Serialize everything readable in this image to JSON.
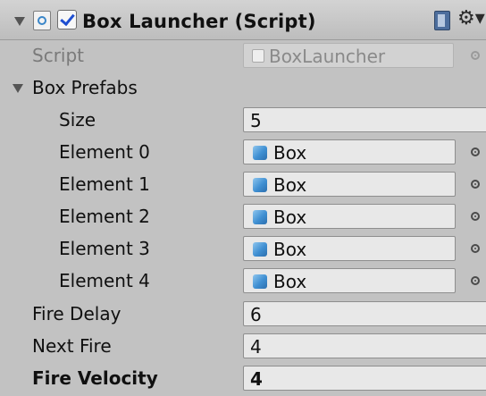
{
  "component": {
    "title": "Box Launcher (Script)",
    "enabled": true
  },
  "script_row": {
    "label": "Script",
    "value": "BoxLauncher"
  },
  "box_prefabs": {
    "label": "Box Prefabs",
    "size_label": "Size",
    "size_value": "5",
    "elements": [
      {
        "label": "Element 0",
        "value": "Box"
      },
      {
        "label": "Element 1",
        "value": "Box"
      },
      {
        "label": "Element 2",
        "value": "Box"
      },
      {
        "label": "Element 3",
        "value": "Box"
      },
      {
        "label": "Element 4",
        "value": "Box"
      }
    ]
  },
  "fields": [
    {
      "label": "Fire Delay",
      "value": "6"
    },
    {
      "label": "Next Fire",
      "value": "4"
    },
    {
      "label": "Fire Velocity",
      "value": "4"
    }
  ],
  "icons": {
    "script": "script-icon",
    "help": "help-book-icon",
    "settings": "gear-icon",
    "object": "cube-icon",
    "picker": "object-picker-icon"
  },
  "colors": {
    "background": "#c2c2c2",
    "field": "#e8e8e8",
    "checkbox_tick": "#1f4fd1",
    "cube": "#3f8fd2"
  }
}
